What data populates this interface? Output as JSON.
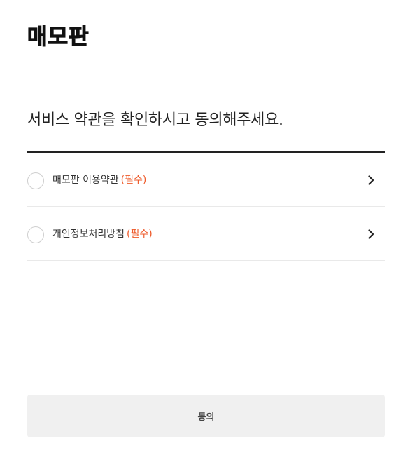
{
  "header": {
    "logo": "매모판"
  },
  "main": {
    "heading": "서비스 약관을 확인하시고 동의해주세요.",
    "terms": [
      {
        "label": "매모판 이용약관",
        "required": "(필수)",
        "checked": false,
        "icon": "chevron-right-icon"
      },
      {
        "label": "개인정보처리방침",
        "required": "(필수)",
        "checked": false,
        "icon": "chevron-right-icon"
      }
    ],
    "agree_button_label": "동의"
  },
  "colors": {
    "required": "#ee5a2a",
    "button_bg": "#f0f0f0",
    "rule": "#222222"
  }
}
